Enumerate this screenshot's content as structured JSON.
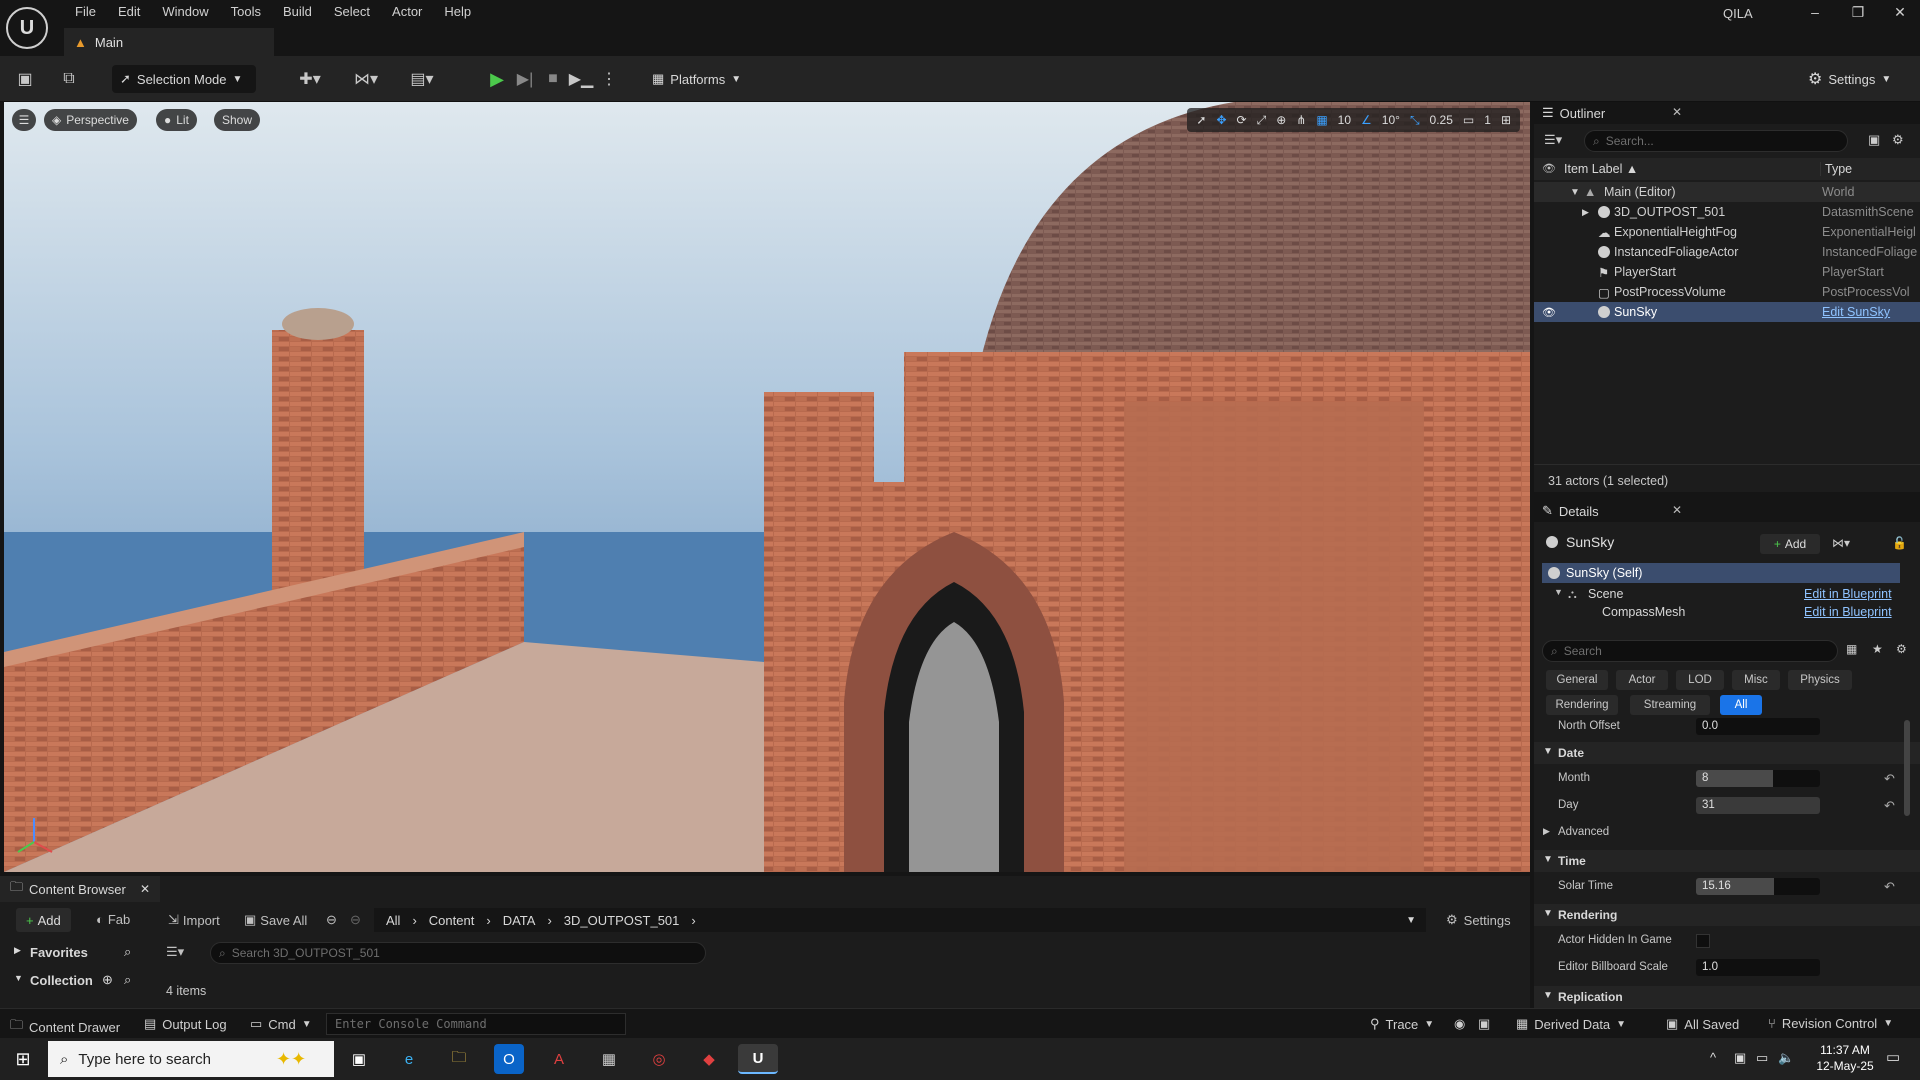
{
  "app": {
    "window_title": "QILA",
    "tab": "Main",
    "menu": [
      "File",
      "Edit",
      "Window",
      "Tools",
      "Build",
      "Select",
      "Actor",
      "Help"
    ]
  },
  "toolbar": {
    "selection_mode": "Selection Mode",
    "platforms": "Platforms",
    "settings": "Settings"
  },
  "viewport": {
    "perspective": "Perspective",
    "lit": "Lit",
    "show": "Show",
    "grid_snap": "10",
    "angle_snap": "10°",
    "scale_snap": "0.25",
    "camera_speed": "1"
  },
  "outliner": {
    "title": "Outliner",
    "search_placeholder": "Search...",
    "col_label": "Item Label ▲",
    "col_type": "Type",
    "rows": [
      {
        "label": "Main (Editor)",
        "type": "World"
      },
      {
        "label": "3D_OUTPOST_501",
        "type": "DatasmithScene"
      },
      {
        "label": "ExponentialHeightFog",
        "type": "ExponentialHeigl"
      },
      {
        "label": "InstancedFoliageActor",
        "type": "InstancedFoliage"
      },
      {
        "label": "PlayerStart",
        "type": "PlayerStart"
      },
      {
        "label": "PostProcessVolume",
        "type": "PostProcessVol"
      },
      {
        "label": "SunSky",
        "type": "Edit SunSky"
      }
    ],
    "status": "31 actors (1 selected)"
  },
  "details": {
    "title": "Details",
    "actor": "SunSky",
    "add": "Add",
    "components": [
      {
        "label": "SunSky (Self)",
        "link": ""
      },
      {
        "label": "Scene",
        "link": "Edit in Blueprint"
      },
      {
        "label": "CompassMesh",
        "link": "Edit in Blueprint"
      }
    ],
    "search_placeholder": "Search",
    "filters_row1": [
      "General",
      "Actor",
      "LOD",
      "Misc",
      "Physics"
    ],
    "filters_row2": [
      "Rendering",
      "Streaming",
      "All"
    ],
    "north_offset_label": "North Offset",
    "north_offset": "0.0",
    "date_section": "Date",
    "month_label": "Month",
    "month": "8",
    "day_label": "Day",
    "day": "31",
    "advanced": "Advanced",
    "time_section": "Time",
    "solar_time_label": "Solar Time",
    "solar_time": "15.16",
    "rendering_section": "Rendering",
    "hidden_label": "Actor Hidden In Game",
    "billboard_label": "Editor Billboard Scale",
    "billboard": "1.0",
    "replication": "Replication"
  },
  "content_browser": {
    "title": "Content Browser",
    "add": "Add",
    "fab": "Fab",
    "import": "Import",
    "save_all": "Save All",
    "breadcrumb": [
      "All",
      "Content",
      "DATA",
      "3D_OUTPOST_501"
    ],
    "settings": "Settings",
    "favorites": "Favorites",
    "collections": "Collection",
    "search_placeholder": "Search 3D_OUTPOST_501",
    "items_count": "4 items"
  },
  "statusbar": {
    "content_drawer": "Content Drawer",
    "output_log": "Output Log",
    "cmd": "Cmd",
    "console_placeholder": "Enter Console Command",
    "trace": "Trace",
    "derived_data": "Derived Data",
    "all_saved": "All Saved",
    "revision_control": "Revision Control"
  },
  "taskbar": {
    "search_placeholder": "Type here to search",
    "time": "11:37 AM",
    "date": "12-May-25"
  }
}
